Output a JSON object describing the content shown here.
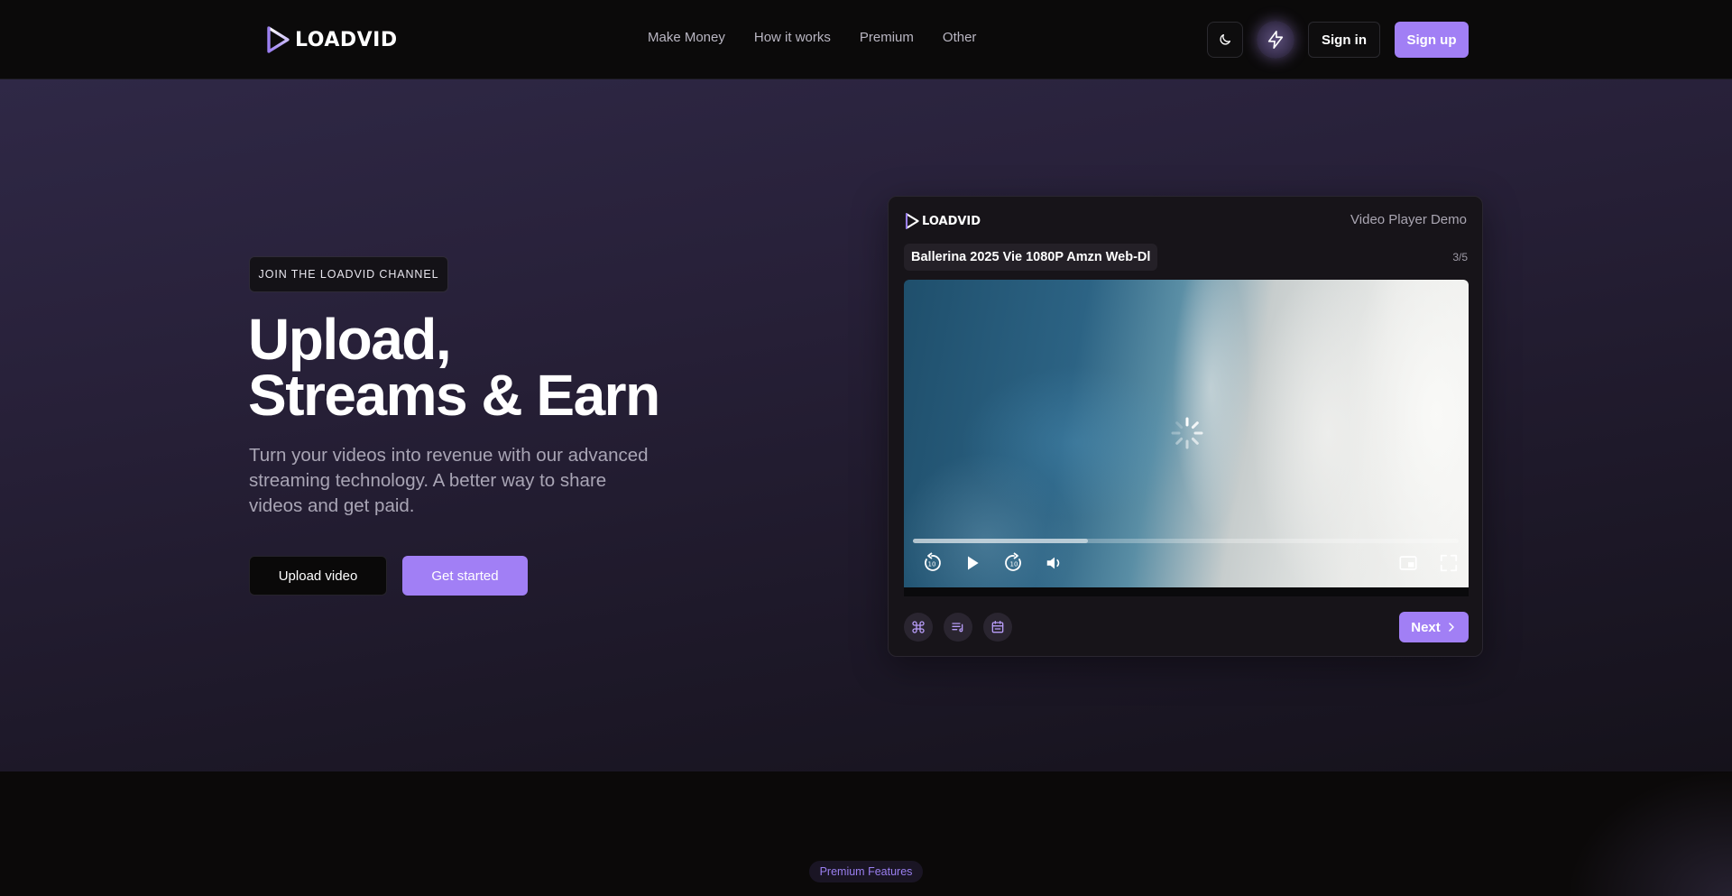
{
  "brand": {
    "name": "LOADVID",
    "accent": "#a17ff5"
  },
  "nav": {
    "items": [
      {
        "label": "Make Money"
      },
      {
        "label": "How it works"
      },
      {
        "label": "Premium"
      },
      {
        "label": "Other"
      }
    ]
  },
  "header": {
    "theme_icon": "moon-icon",
    "bolt_icon": "bolt-icon",
    "sign_in_label": "Sign in",
    "sign_up_label": "Sign up"
  },
  "hero": {
    "badge": "JOIN THE LOADVID CHANNEL",
    "title_line1": "Upload,",
    "title_line2": "Streams & Earn",
    "subtitle": "Turn your videos into revenue with our advanced streaming technology. A better way to share videos and get paid.",
    "upload_label": "Upload video",
    "get_started_label": "Get started"
  },
  "player": {
    "brand": "LOADVID",
    "demo_label": "Video Player Demo",
    "video_title": "Ballerina 2025 Vie 1080P Amzn Web-Dl",
    "counter": "3/5",
    "progress_fraction": 0.32,
    "controls": [
      "rewind-10-icon",
      "play-icon",
      "forward-10-icon",
      "volume-icon",
      "picture-in-picture-icon",
      "fullscreen-icon"
    ],
    "bottom_icons": [
      "command-icon",
      "playlist-icon",
      "calendar-icon"
    ],
    "next_label": "Next"
  },
  "footer_section": {
    "pill": "Premium Features"
  }
}
